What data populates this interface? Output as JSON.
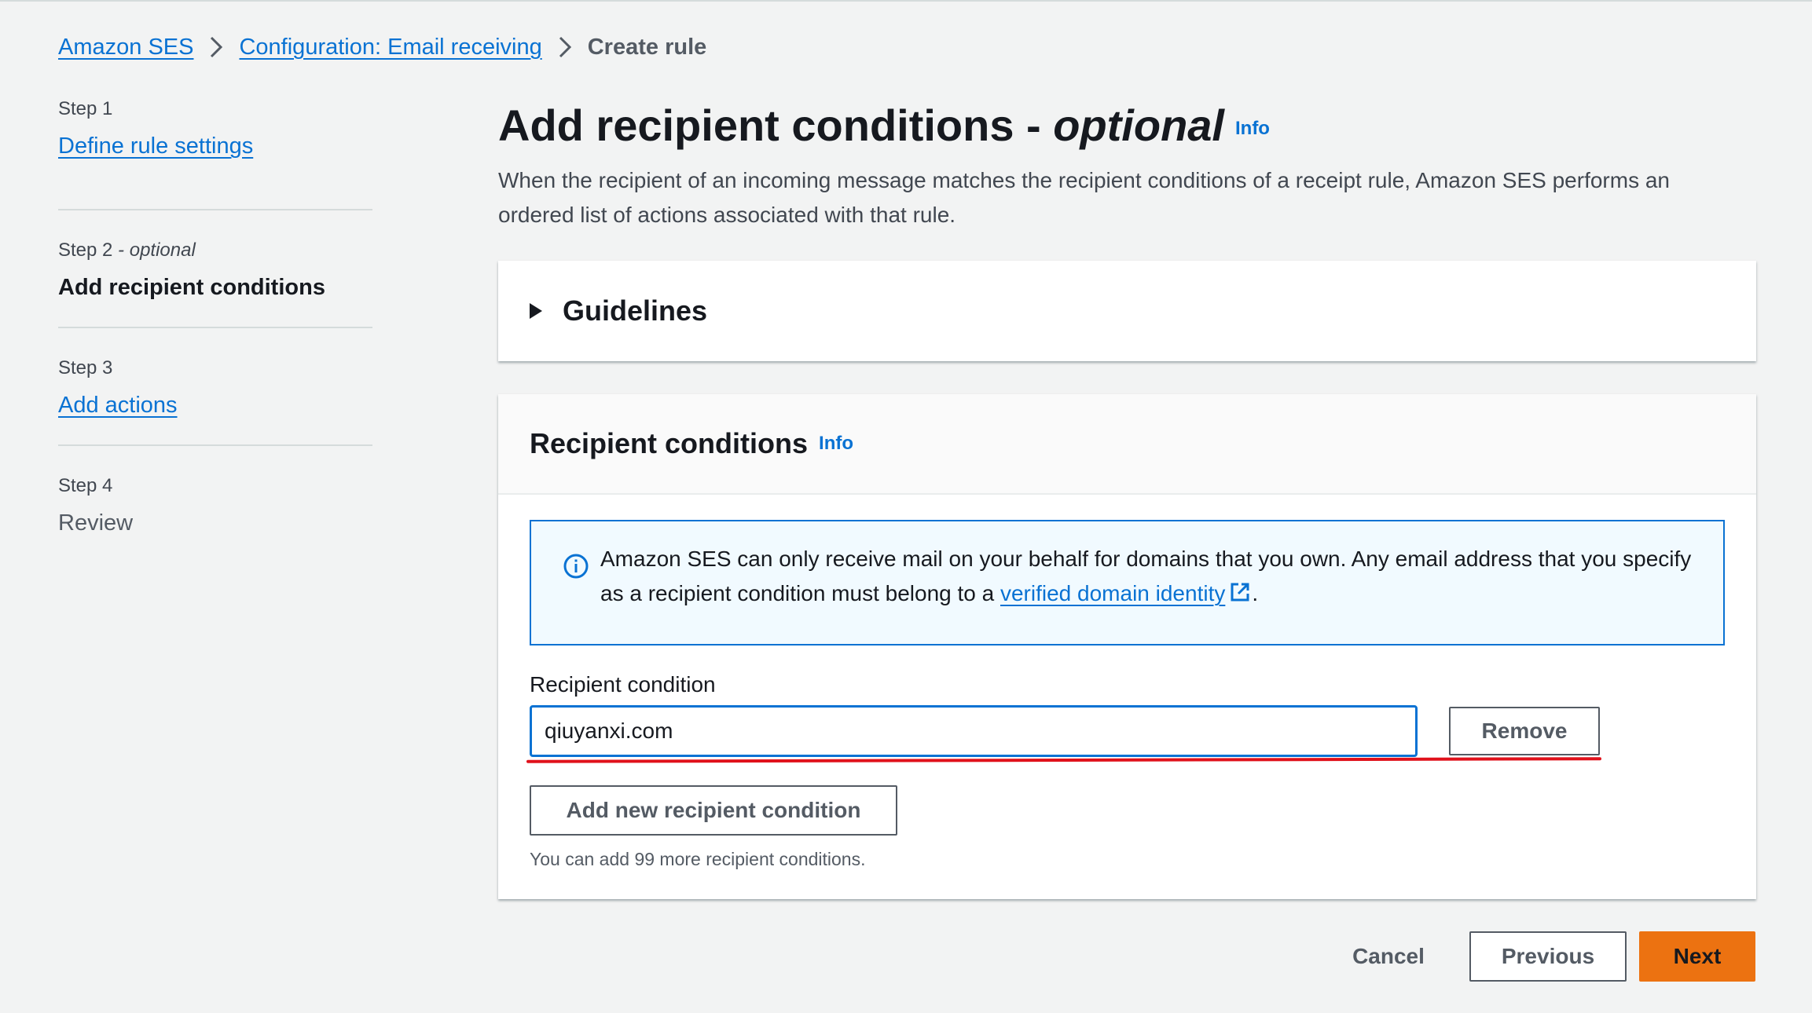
{
  "breadcrumb": {
    "items": [
      {
        "label": "Amazon SES"
      },
      {
        "label": "Configuration: Email receiving"
      },
      {
        "label": "Create rule"
      }
    ]
  },
  "steps": [
    {
      "num": "Step 1",
      "title": "Define rule settings",
      "state": "link"
    },
    {
      "num": "Step 2",
      "optional": " - optional",
      "title": "Add recipient conditions",
      "state": "active"
    },
    {
      "num": "Step 3",
      "title": "Add actions",
      "state": "link"
    },
    {
      "num": "Step 4",
      "title": "Review",
      "state": "disabled"
    }
  ],
  "header": {
    "title_main": "Add recipient conditions - ",
    "title_em": "optional",
    "info": "Info",
    "description": "When the recipient of an incoming message matches the recipient conditions of a receipt rule, Amazon SES performs an ordered list of actions associated with that rule."
  },
  "guidelines": {
    "title": "Guidelines"
  },
  "recipient_conditions": {
    "title": "Recipient conditions",
    "info": "Info",
    "alert_text": "Amazon SES can only receive mail on your behalf for domains that you own. Any email address that you specify as a recipient condition must belong to a ",
    "alert_link": "verified domain identity",
    "alert_end": ".",
    "field_label": "Recipient condition",
    "field_value": "qiuyanxi.com",
    "remove_label": "Remove",
    "add_label": "Add new recipient condition",
    "hint": "You can add 99 more recipient conditions."
  },
  "footer": {
    "cancel": "Cancel",
    "previous": "Previous",
    "next": "Next"
  },
  "colors": {
    "accent": "#0972d3",
    "primary_button": "#ec7211",
    "annotation": "#e0111b"
  },
  "icons": {
    "breadcrumb_separator": "chevron-right-icon",
    "expander": "caret-right-icon",
    "alert": "info-circle-icon",
    "link": "external-link-icon"
  }
}
